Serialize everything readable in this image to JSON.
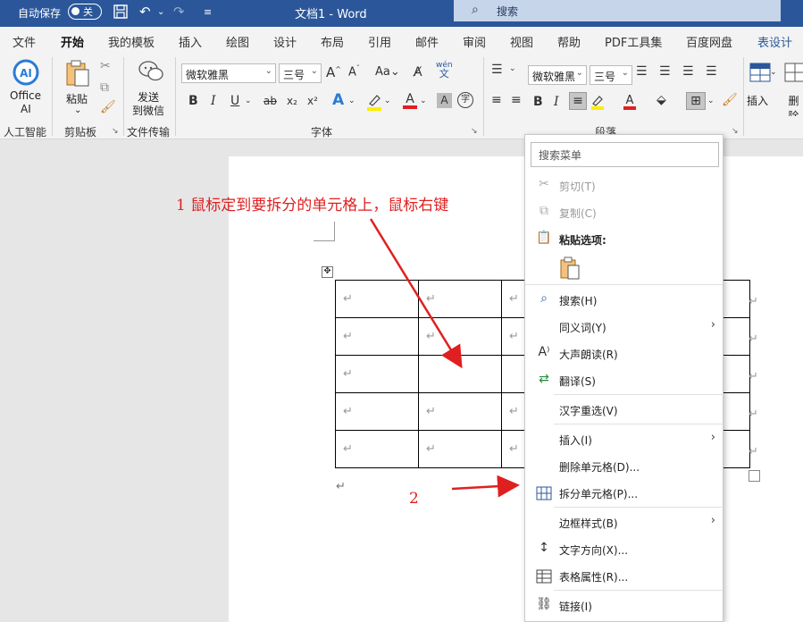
{
  "titlebar": {
    "autosave_label": "自动保存",
    "autosave_state": "关",
    "doc_title": "文档1  -  Word",
    "search_label": "搜索"
  },
  "tabs": [
    "文件",
    "开始",
    "我的模板",
    "插入",
    "绘图",
    "设计",
    "布局",
    "引用",
    "邮件",
    "审阅",
    "视图",
    "帮助",
    "PDF工具集",
    "百度网盘",
    "表设计"
  ],
  "active_tab": "开始",
  "ribbon": {
    "office_ai_line1": "Office",
    "office_ai_line2": "AI",
    "paste_label": "粘贴",
    "send_line1": "发送",
    "send_line2": "到微信",
    "font_name": "微软雅黑",
    "font_size": "三号",
    "font_name_2": "微软雅黑",
    "font_size_2": "三号",
    "insert_label": "插入",
    "delete_label": "删除",
    "groups": {
      "ai": "人工智能",
      "clipboard": "剪贴板",
      "transfer": "文件传输",
      "font": "字体",
      "paragraph": "段落"
    },
    "font_buttons": {
      "bold": "B",
      "italic": "I",
      "underline": "U",
      "strike": "ab",
      "sub": "x₂",
      "sup": "x²",
      "grow": "A^",
      "shrink": "Aˇ",
      "case": "Aa",
      "wen": "wén 文",
      "clear": "A",
      "enclose": "字"
    }
  },
  "annotations": {
    "step1": "1  鼠标定到要拆分的单元格上，鼠标右键",
    "step2": "2"
  },
  "table": {
    "rows": [
      [
        "↵",
        "↵",
        "↵",
        "",
        "",
        ""
      ],
      [
        "↵",
        "↵",
        "↵",
        "",
        "",
        ""
      ],
      [
        "↵",
        "",
        "",
        "",
        "",
        ""
      ],
      [
        "↵",
        "↵",
        "↵",
        "",
        "",
        ""
      ],
      [
        "↵",
        "↵",
        "↵",
        "",
        "",
        ""
      ]
    ],
    "row_end_mark": "↵",
    "para_mark": "↵"
  },
  "context_menu": {
    "search_placeholder": "搜索菜单",
    "items": [
      {
        "label": "剪切(T)",
        "icon": "scissors-icon",
        "disabled": true
      },
      {
        "label": "复制(C)",
        "icon": "copy-icon",
        "disabled": true
      },
      {
        "label": "粘贴选项:",
        "icon": "paste-icon",
        "bold": true
      },
      {
        "label": "",
        "icon": "paste-keep-icon"
      },
      {
        "label": "搜索(H)",
        "icon": "search-icon"
      },
      {
        "label": "同义词(Y)",
        "icon": "",
        "submenu": true
      },
      {
        "label": "大声朗读(R)",
        "icon": "read-aloud-icon"
      },
      {
        "label": "翻译(S)",
        "icon": "translate-icon"
      },
      {
        "label": "汉字重选(V)",
        "icon": ""
      },
      {
        "label": "插入(I)",
        "icon": "",
        "submenu": true
      },
      {
        "label": "删除单元格(D)...",
        "icon": ""
      },
      {
        "label": "拆分单元格(P)...",
        "icon": "split-cells-icon"
      },
      {
        "label": "边框样式(B)",
        "icon": "",
        "submenu": true
      },
      {
        "label": "文字方向(X)...",
        "icon": "text-direction-icon"
      },
      {
        "label": "表格属性(R)...",
        "icon": "table-properties-icon"
      },
      {
        "label": "链接(I)",
        "icon": "link-icon"
      }
    ]
  },
  "colors": {
    "titlebar": "#2b579a",
    "annotation": "#e02020",
    "ribbon_bg": "#f3f3f3"
  }
}
